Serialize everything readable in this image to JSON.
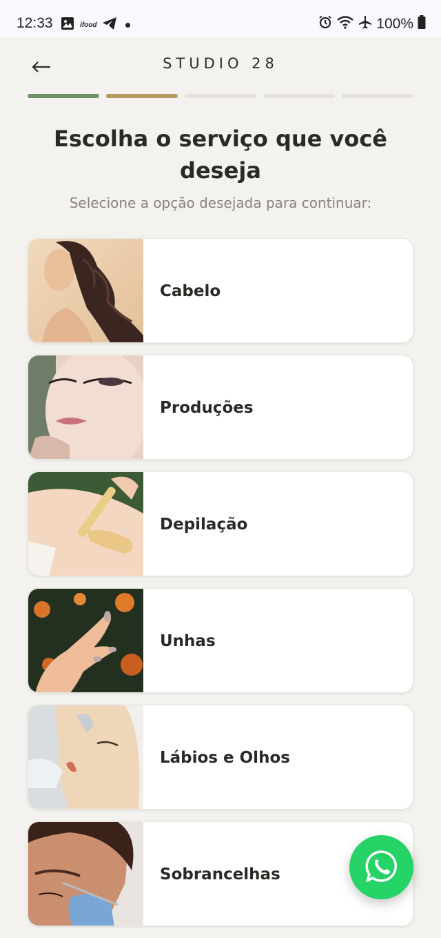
{
  "status_bar": {
    "time": "12:33",
    "notif_ifood": "ifood",
    "battery": "100%"
  },
  "header": {
    "back_icon": "arrow-left-icon",
    "brand": "STUDIO 28"
  },
  "progress": {
    "total_steps": 5,
    "completed_steps": 2,
    "colors": [
      "#6d9462",
      "#b99a5c",
      "#e6e3de",
      "#e6e3de",
      "#e6e3de"
    ]
  },
  "page": {
    "title": "Escolha o serviço que você deseja",
    "subtitle": "Selecione a opção desejada para continuar:"
  },
  "services": [
    {
      "label": "Cabelo",
      "image": "hair-photo"
    },
    {
      "label": "Produções",
      "image": "makeup-photo"
    },
    {
      "label": "Depilação",
      "image": "waxing-photo"
    },
    {
      "label": "Unhas",
      "image": "nails-photo"
    },
    {
      "label": "Lábios e Olhos",
      "image": "lips-eyes-photo"
    },
    {
      "label": "Sobrancelhas",
      "image": "eyebrows-photo"
    }
  ],
  "fab": {
    "icon": "whatsapp-icon",
    "color": "#25d366"
  }
}
